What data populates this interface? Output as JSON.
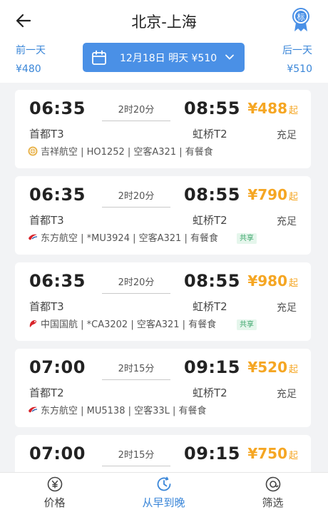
{
  "header": {
    "title": "北京-上海",
    "badge_text": "标",
    "prev_day": {
      "label": "前一天",
      "price": "¥480"
    },
    "next_day": {
      "label": "后一天",
      "price": "¥510"
    },
    "date_selector": {
      "text": "12月18日 明天 ¥510"
    }
  },
  "colors": {
    "accent_blue": "#4a90e6",
    "price_orange": "#f5a623",
    "share_green": "#3aa56a"
  },
  "flights": [
    {
      "dep_time": "06:35",
      "arr_time": "08:55",
      "duration": "2时20分",
      "dep_airport": "首都T3",
      "arr_airport": "虹桥T2",
      "price_symbol": "¥",
      "price": "488",
      "price_suffix": "起",
      "status": "充足",
      "airline_logo": "juneyao-logo",
      "info": "吉祥航空 | HO1252 | 空客A321 | 有餐食",
      "share_tag": ""
    },
    {
      "dep_time": "06:35",
      "arr_time": "08:55",
      "duration": "2时20分",
      "dep_airport": "首都T3",
      "arr_airport": "虹桥T2",
      "price_symbol": "¥",
      "price": "790",
      "price_suffix": "起",
      "status": "充足",
      "airline_logo": "china-eastern-logo",
      "info": "东方航空 | *MU3924 | 空客A321 | 有餐食",
      "share_tag": "共享"
    },
    {
      "dep_time": "06:35",
      "arr_time": "08:55",
      "duration": "2时20分",
      "dep_airport": "首都T3",
      "arr_airport": "虹桥T2",
      "price_symbol": "¥",
      "price": "980",
      "price_suffix": "起",
      "status": "充足",
      "airline_logo": "air-china-logo",
      "info": "中国国航 | *CA3202 | 空客A321 | 有餐食",
      "share_tag": "共享"
    },
    {
      "dep_time": "07:00",
      "arr_time": "09:15",
      "duration": "2时15分",
      "dep_airport": "首都T2",
      "arr_airport": "虹桥T2",
      "price_symbol": "¥",
      "price": "520",
      "price_suffix": "起",
      "status": "充足",
      "airline_logo": "china-eastern-logo",
      "info": "东方航空 | MU5138 | 空客33L | 有餐食",
      "share_tag": ""
    },
    {
      "dep_time": "07:00",
      "arr_time": "09:15",
      "duration": "2时15分",
      "dep_airport": "",
      "arr_airport": "",
      "price_symbol": "¥",
      "price": "750",
      "price_suffix": "起",
      "status": "",
      "airline_logo": "",
      "info": "",
      "share_tag": ""
    }
  ],
  "tabbar": {
    "tabs": [
      {
        "label": "价格",
        "icon": "price-icon"
      },
      {
        "label": "从早到晚",
        "icon": "clock-icon"
      },
      {
        "label": "筛选",
        "icon": "filter-icon"
      }
    ],
    "active_index": 1
  }
}
